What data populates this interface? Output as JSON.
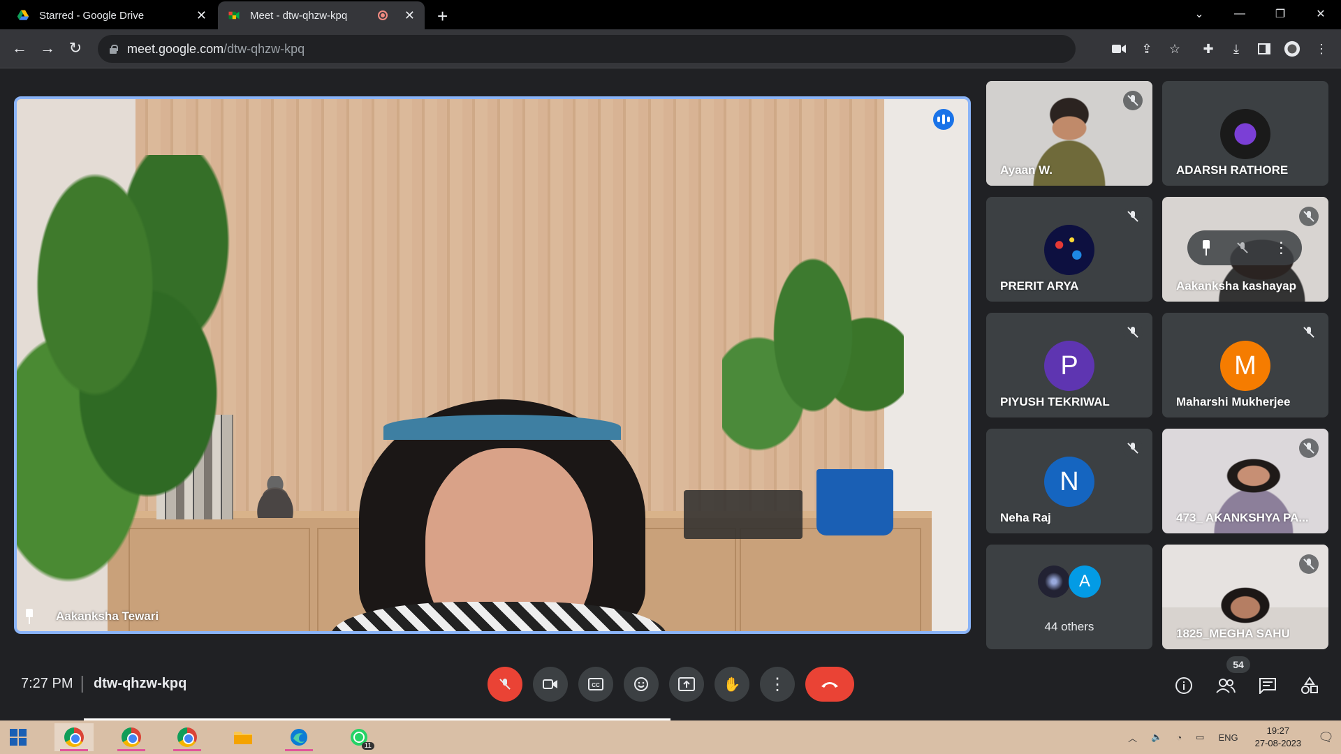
{
  "browser": {
    "tabs": [
      {
        "title": "Starred - Google Drive",
        "active": false
      },
      {
        "title": "Meet - dtw-qhzw-kpq",
        "active": true
      }
    ],
    "url_host": "meet.google.com",
    "url_path": "/dtw-qhzw-kpq"
  },
  "main": {
    "speaker_name": "Aakanksha Tewari"
  },
  "participants": [
    {
      "name": "Ayaan W.",
      "type": "video",
      "muted": true
    },
    {
      "name": "ADARSH RATHORE",
      "type": "avatar-image",
      "muted": false
    },
    {
      "name": "PRERIT ARYA",
      "type": "avatar-image",
      "muted": true
    },
    {
      "name": "Aakanksha kashayap",
      "type": "video",
      "muted": true
    },
    {
      "name": "PIYUSH TEKRIWAL",
      "type": "initial",
      "initial": "P",
      "color": "#5e35b1",
      "muted": true
    },
    {
      "name": "Maharshi Mukherjee",
      "type": "initial",
      "initial": "M",
      "color": "#f57c00",
      "muted": true
    },
    {
      "name": "Neha Raj",
      "type": "initial",
      "initial": "N",
      "color": "#1565c0",
      "muted": true
    },
    {
      "name": "473_ AKANKSHYA PA...",
      "type": "video",
      "muted": true
    },
    {
      "name": "1825_MEGHA SAHU",
      "type": "video",
      "muted": true
    }
  ],
  "others": {
    "label": "44 others",
    "initial": "A",
    "color": "#039be5"
  },
  "bottom": {
    "time": "7:27 PM",
    "meeting_code": "dtw-qhzw-kpq",
    "people_count": "54"
  },
  "taskbar": {
    "language": "ENG",
    "clock_time": "19:27",
    "clock_date": "27-08-2023",
    "whatsapp_badge": "11"
  },
  "colors": {
    "accent": "#8ab4f8",
    "danger": "#ea4335",
    "surface": "#3c4043",
    "background": "#202124"
  }
}
